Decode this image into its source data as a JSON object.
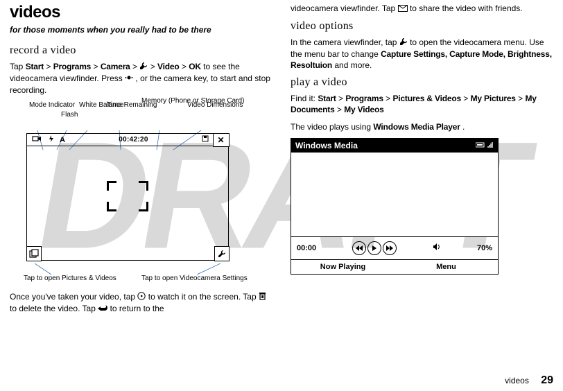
{
  "watermark": "DRAFT",
  "left": {
    "title": "videos",
    "tagline": "for those moments when you really had to be there",
    "h_record": "record a video",
    "p_record_1a": "Tap ",
    "path_start": "Start",
    "gt1": " > ",
    "path_programs": "Programs",
    "gt2": " > ",
    "path_camera": "Camera",
    "gt3": " > ",
    "path_video": "Video",
    "gt4": " > ",
    "path_ok": "OK",
    "p_record_1b": " to see the videocamera viewfinder. Press ",
    "p_record_1c": ", or the camera key, to start and stop recording.",
    "labels": {
      "mode": "Mode Indicator",
      "flash": "Flash",
      "white": "White Balance",
      "time": "Time Remaining",
      "memory": "Memory (Phone or Storage Card)",
      "dims": "Video Dimensions"
    },
    "vf_time": "00:42:20",
    "vf_flash": "A",
    "open_pv": "Tap to open Pictures & Videos",
    "open_settings": "Tap to open Videocamera Settings",
    "p_after_a": "Once you've taken your video, tap ",
    "p_after_b": " to watch it on the screen. Tap ",
    "p_after_c": " to delete the video. Tap ",
    "p_after_d": " to return to the"
  },
  "right": {
    "p_cont_a": "videocamera viewfinder. Tap ",
    "p_cont_b": " to share the video with friends.",
    "h_options": "video options",
    "p_options_a": "In the camera viewfinder, tap ",
    "p_options_b": " to open the videocamera menu. Use the menu bar to change ",
    "opt_list": "Capture Settings, Capture Mode, Brightness, Resoltuion",
    "p_options_c": " and more.",
    "h_play": "play a video",
    "findit": "Find it:",
    "path_start": "Start",
    "gt1": " > ",
    "path_programs": "Programs",
    "gt2": " > ",
    "path_pv": "Pictures & Videos",
    "gt3": "> ",
    "path_myp": "My Pictures",
    "gt4": " > ",
    "path_mydocs": "My Documents",
    "gt5": " > ",
    "path_myvid": "My Videos",
    "p_plays_a": "The video plays using ",
    "wmp": "Windows Media Player",
    "p_plays_b": ".",
    "player": {
      "title": "Windows Media",
      "time": "00:00",
      "vol": "70%",
      "left_soft": "Now Playing",
      "right_soft": "Menu"
    }
  },
  "footer": {
    "section": "videos",
    "page": "29"
  }
}
